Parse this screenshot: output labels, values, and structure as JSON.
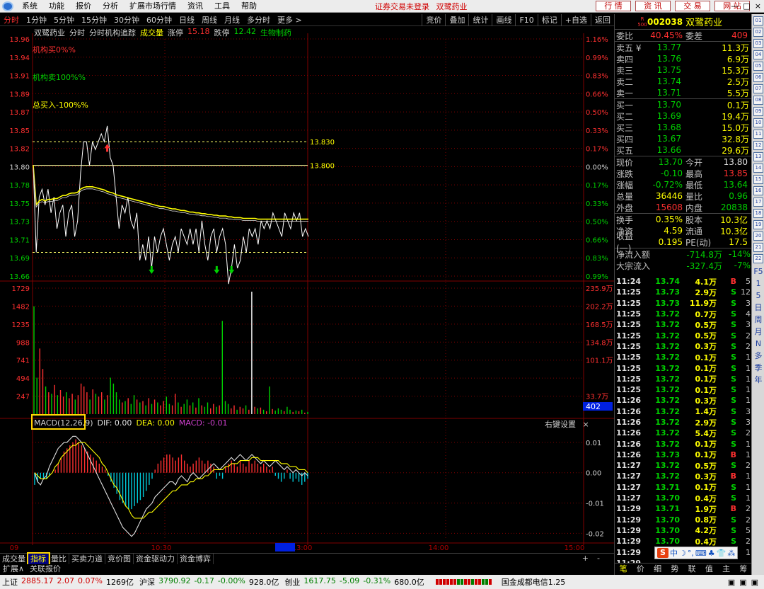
{
  "menubar": {
    "items": [
      "系统",
      "功能",
      "报价",
      "分析",
      "扩展市场行情",
      "资讯",
      "工具",
      "帮助"
    ],
    "login_status": "证券交易未登录",
    "login_stock": "双鹭药业",
    "buttons": [
      "行 情",
      "资 讯",
      "交 易",
      "网 站"
    ],
    "window_controls": [
      "—",
      "□",
      "×"
    ]
  },
  "periods": {
    "items": [
      "分时",
      "1分钟",
      "5分钟",
      "15分钟",
      "30分钟",
      "60分钟",
      "日线",
      "周线",
      "月线",
      "多分时",
      "更多 >"
    ],
    "active_index": 0,
    "tools": [
      "竞价",
      "叠加",
      "统计",
      "画线",
      "F10",
      "标记",
      "+自选",
      "返回"
    ]
  },
  "chart_header": {
    "stock_name": "双鹭药业",
    "mode": "分时",
    "tracker": "分时机构追踪",
    "volume_label": "成交量",
    "limit_up_label": "涨停",
    "limit_up_value": "15.18",
    "limit_down_label": "跌停",
    "limit_down_value": "12.42",
    "sector": "生物制药"
  },
  "overlay_labels": {
    "institution_buy": "机构买0%%",
    "institution_sell": "机构卖100%%",
    "total_buy": "总买入-100%%"
  },
  "macd_legend": {
    "title": "MACD(12,26,9)",
    "dif": "DIF: 0.00",
    "dea": "DEA: 0.00",
    "macd": "MACD: -0.01",
    "right_settings": "右键设置",
    "close": "×"
  },
  "chart_data": {
    "type": "line",
    "title": "",
    "price_axis": {
      "ticks": [
        "13.96",
        "13.94",
        "13.91",
        "13.89",
        "13.87",
        "13.85",
        "13.82",
        "13.80",
        "13.78",
        "13.75",
        "13.73",
        "13.71",
        "13.69",
        "13.66"
      ],
      "min": 13.66,
      "max": 13.96,
      "prev_close": 13.8
    },
    "pct_axis": {
      "ticks": [
        "1.16%",
        "0.99%",
        "0.83%",
        "0.66%",
        "0.50%",
        "0.33%",
        "0.17%",
        "0.00%",
        "0.17%",
        "0.33%",
        "0.50%",
        "0.66%",
        "0.83%",
        "0.99%"
      ]
    },
    "reference_lines": [
      {
        "label": "13.830",
        "value": 13.83
      },
      {
        "label": "13.800",
        "value": 13.8
      },
      {
        "label": "",
        "value": 13.69
      }
    ],
    "volume_axis": {
      "left_ticks": [
        "1729",
        "1482",
        "1235",
        "988",
        "741",
        "494",
        "247"
      ],
      "right_ticks": [
        "235.9万",
        "202.2万",
        "168.5万",
        "134.8万",
        "101.1万",
        "",
        "33.7万"
      ],
      "max": 1729,
      "cursor_label": "402"
    },
    "macd_axis": {
      "ticks": [
        "0.01",
        "0.00",
        "-0.01",
        "-0.02"
      ],
      "min": -0.022,
      "max": 0.013
    },
    "time_axis": {
      "labels": [
        "09",
        "10:30",
        "11:23",
        "13:00",
        "14:00",
        "15:00"
      ],
      "cursor_label": "11:23"
    },
    "series": [
      {
        "kind": "price",
        "values": [
          13.8,
          13.69,
          13.76,
          13.77,
          13.75,
          13.77,
          13.74,
          13.76,
          13.72,
          13.74,
          13.75,
          13.71,
          13.74,
          13.75,
          13.71,
          13.73,
          13.79,
          13.83,
          13.83,
          13.8,
          13.83,
          13.82,
          13.83,
          13.84,
          13.83,
          13.85,
          13.81,
          13.8,
          13.76,
          13.72,
          13.75,
          13.74,
          13.76,
          13.73,
          13.72,
          13.74,
          13.68,
          13.7,
          13.68,
          13.71,
          13.67,
          13.71,
          13.69,
          13.71,
          13.72,
          13.7,
          13.68,
          13.7,
          13.71,
          13.69,
          13.72,
          13.71,
          13.7,
          13.72,
          13.7,
          13.72,
          13.69,
          13.73,
          13.7,
          13.68,
          13.71,
          13.72,
          13.69,
          13.71,
          13.72,
          13.7,
          13.65,
          13.67,
          13.7,
          13.67,
          13.68,
          13.71,
          13.69,
          13.72,
          13.71,
          13.72,
          13.7,
          13.73,
          13.72,
          13.73,
          13.72,
          13.74,
          13.73,
          13.72,
          13.71,
          13.74,
          13.73,
          13.72,
          13.74,
          13.73,
          13.74,
          13.71,
          13.72,
          13.71
        ],
        "style": "white"
      },
      {
        "kind": "avg_price",
        "values": [
          13.8,
          13.75,
          13.755,
          13.757,
          13.755,
          13.757,
          13.757,
          13.758,
          13.758,
          13.76,
          13.762,
          13.762,
          13.764,
          13.765,
          13.765,
          13.766,
          13.77,
          13.772,
          13.773,
          13.773,
          13.773,
          13.772,
          13.771,
          13.77,
          13.769,
          13.767,
          13.766,
          13.765,
          13.763,
          13.762,
          13.761,
          13.76,
          13.759,
          13.758,
          13.757,
          13.756,
          13.755,
          13.754,
          13.753,
          13.752,
          13.751,
          13.75,
          13.749,
          13.748,
          13.748,
          13.747,
          13.746,
          13.745,
          13.745,
          13.744,
          13.743,
          13.743,
          13.742,
          13.741,
          13.741,
          13.74,
          13.74,
          13.739,
          13.739,
          13.738,
          13.738,
          13.737,
          13.737,
          13.736,
          13.736,
          13.736,
          13.735,
          13.735,
          13.734,
          13.734,
          13.734,
          13.733,
          13.733,
          13.733,
          13.733,
          13.733,
          13.732,
          13.732,
          13.732,
          13.732,
          13.732,
          13.732,
          13.732,
          13.732,
          13.732,
          13.732,
          13.732,
          13.732,
          13.732,
          13.732,
          13.732,
          13.732,
          13.732,
          13.732
        ],
        "style": "yellow"
      }
    ],
    "arrows": [
      {
        "type": "buy",
        "index": 25,
        "value": 13.82
      },
      {
        "type": "sell",
        "index": 40,
        "value": 13.67
      },
      {
        "type": "sell",
        "index": 62,
        "value": 13.67
      },
      {
        "type": "sell",
        "index": 67,
        "value": 13.67
      }
    ],
    "volumes": [
      1480,
      500,
      900,
      620,
      380,
      300,
      280,
      400,
      260,
      330,
      240,
      300,
      220,
      280,
      200,
      260,
      420,
      380,
      300,
      200,
      340,
      280,
      240,
      300,
      200,
      260,
      500,
      420,
      300,
      200,
      160,
      180,
      220,
      140,
      260,
      200,
      160,
      180,
      120,
      220,
      140,
      200,
      160,
      120,
      180,
      240,
      140,
      120,
      280,
      160,
      100,
      140,
      200,
      120,
      160,
      90,
      220,
      120,
      100,
      160,
      80,
      140,
      100,
      120,
      1280,
      180,
      140,
      80,
      120,
      60,
      100,
      80,
      120,
      60,
      1680,
      100,
      80,
      90,
      60,
      40,
      380,
      70,
      50,
      80,
      60,
      40,
      100,
      60,
      30,
      50,
      40,
      60,
      20,
      30
    ],
    "macd_hist": [
      -0.004,
      -0.003,
      -0.002,
      -0.002,
      -0.002,
      -0.001,
      0.0,
      0.001,
      0.003,
      0.005,
      0.007,
      0.008,
      0.009,
      0.01,
      0.011,
      0.01,
      0.009,
      0.008,
      0.007,
      0.006,
      0.005,
      0.004,
      0.003,
      0.002,
      0.001,
      -0.001,
      -0.003,
      -0.005,
      -0.007,
      -0.009,
      -0.01,
      -0.011,
      -0.012,
      -0.012,
      -0.011,
      -0.01,
      -0.009,
      -0.008,
      -0.006,
      -0.004,
      -0.002,
      0.001,
      0.003,
      0.004,
      0.005,
      0.006,
      0.006,
      0.005,
      0.004,
      0.005,
      0.006,
      0.004,
      0.003,
      0.002,
      0.003,
      0.004,
      0.005,
      0.004,
      0.003,
      0.004,
      0.003,
      0.002,
      -0.002,
      -0.001,
      -0.002,
      0.002,
      0.003,
      0.004,
      0.003,
      0.002,
      0.004,
      0.003,
      0.002,
      0.004,
      0.003,
      0.004,
      0.003,
      0.002,
      0.003,
      0.002,
      0.001,
      0.002,
      -0.001,
      -0.002,
      -0.003,
      -0.002,
      0.001,
      -0.002,
      -0.003,
      -0.002,
      -0.003,
      -0.004,
      -0.003,
      -0.002
    ],
    "macd_dif": [
      0.0,
      -0.003,
      -0.004,
      -0.002,
      -0.001,
      0.002,
      0.004,
      0.006,
      0.008,
      0.009,
      0.01,
      0.01,
      0.011,
      0.012,
      0.012,
      0.011,
      0.01,
      0.008,
      0.006,
      0.004,
      0.002,
      0.0,
      -0.002,
      -0.004,
      -0.006,
      -0.008,
      -0.01,
      -0.012,
      -0.014,
      -0.016,
      -0.018,
      -0.019,
      -0.02,
      -0.021,
      -0.02,
      -0.018,
      -0.016,
      -0.014,
      -0.012,
      -0.011,
      -0.01,
      -0.008,
      -0.007,
      -0.006,
      -0.005,
      -0.004,
      -0.003,
      -0.003,
      -0.004,
      -0.002,
      -0.001,
      -0.002,
      -0.003,
      -0.001,
      0.0,
      -0.001,
      -0.002,
      -0.001,
      0.0,
      0.001,
      0.002,
      0.003,
      0.002,
      0.001,
      0.002,
      0.003,
      0.004,
      0.005,
      0.004,
      0.005,
      0.006,
      0.005,
      0.004,
      0.005,
      0.006,
      0.005,
      0.004,
      0.003,
      0.004,
      0.003,
      0.002,
      0.003,
      0.004,
      0.003,
      0.002,
      0.001,
      0.002,
      0.001,
      0.0,
      0.001,
      0.0,
      -0.001,
      0.0,
      -0.001
    ],
    "macd_dea": [
      0.0,
      -0.001,
      -0.002,
      -0.002,
      -0.002,
      -0.001,
      0.0,
      0.002,
      0.003,
      0.005,
      0.006,
      0.007,
      0.008,
      0.009,
      0.009,
      0.01,
      0.01,
      0.01,
      0.009,
      0.008,
      0.007,
      0.006,
      0.005,
      0.003,
      0.002,
      0.0,
      -0.002,
      -0.004,
      -0.005,
      -0.007,
      -0.009,
      -0.011,
      -0.012,
      -0.014,
      -0.015,
      -0.015,
      -0.015,
      -0.015,
      -0.014,
      -0.013,
      -0.013,
      -0.012,
      -0.011,
      -0.01,
      -0.009,
      -0.008,
      -0.007,
      -0.006,
      -0.006,
      -0.005,
      -0.004,
      -0.004,
      -0.004,
      -0.003,
      -0.003,
      -0.002,
      -0.002,
      -0.002,
      -0.001,
      -0.001,
      0.0,
      0.001,
      0.001,
      0.001,
      0.001,
      0.002,
      0.002,
      0.003,
      0.003,
      0.003,
      0.004,
      0.004,
      0.004,
      0.004,
      0.005,
      0.005,
      0.005,
      0.004,
      0.004,
      0.004,
      0.004,
      0.004,
      0.004,
      0.004,
      0.003,
      0.003,
      0.003,
      0.002,
      0.002,
      0.002,
      0.001,
      0.001,
      0.001,
      0.0
    ]
  },
  "bottom_tabs": {
    "items": [
      "成交量",
      "指标",
      "量比",
      "买卖力道",
      "竞价图",
      "资金驱动力",
      "资金博弈"
    ],
    "active_index": 1,
    "controls": [
      "+",
      "-"
    ],
    "expand_row": [
      "扩展∧",
      "关联报价"
    ]
  },
  "statusbar": {
    "indices": [
      {
        "name": "上证",
        "value": "2885.17",
        "change": "2.07",
        "pct": "0.07%",
        "amount": "1269亿",
        "dir": "up"
      },
      {
        "name": "沪深",
        "value": "3790.92",
        "change": "-0.17",
        "pct": "-0.00%",
        "amount": "928.0亿",
        "dir": "down"
      },
      {
        "name": "创业",
        "value": "1617.75",
        "change": "-5.09",
        "pct": "-0.31%",
        "amount": "680.0亿",
        "dir": "down"
      }
    ],
    "news": "国金成都电信1.25"
  },
  "quote": {
    "r_badge": "R 500",
    "code": "002038",
    "name": "双鹭药业",
    "ratio_label": "委比",
    "ratio_value": "40.45%",
    "diff_label": "委差",
    "diff_value": "409",
    "asks": [
      {
        "label": "卖五 ¥",
        "price": "13.77",
        "vol": "11.3万"
      },
      {
        "label": "卖四",
        "price": "13.76",
        "vol": "6.9万"
      },
      {
        "label": "卖三",
        "price": "13.75",
        "vol": "15.3万"
      },
      {
        "label": "卖二",
        "price": "13.74",
        "vol": "2.5万"
      },
      {
        "label": "卖一",
        "price": "13.71",
        "vol": "5.5万"
      }
    ],
    "bids": [
      {
        "label": "买一",
        "price": "13.70",
        "vol": "0.1万"
      },
      {
        "label": "买二",
        "price": "13.69",
        "vol": "19.4万"
      },
      {
        "label": "买三",
        "price": "13.68",
        "vol": "15.0万"
      },
      {
        "label": "买四",
        "price": "13.67",
        "vol": "32.8万"
      },
      {
        "label": "买五",
        "price": "13.66",
        "vol": "29.6万"
      }
    ],
    "fields": [
      {
        "l1": "现价",
        "v1": "13.70",
        "c1": "down",
        "l2": "今开",
        "v2": "13.80",
        "c2": "wht"
      },
      {
        "l1": "涨跌",
        "v1": "-0.10",
        "c1": "down",
        "l2": "最高",
        "v2": "13.85",
        "c2": "up"
      },
      {
        "l1": "涨幅",
        "v1": "-0.72%",
        "c1": "down",
        "l2": "最低",
        "v2": "13.64",
        "c2": "down"
      },
      {
        "l1": "总量",
        "v1": "36446",
        "c1": "yel",
        "l2": "量比",
        "v2": "0.96",
        "c2": "down"
      },
      {
        "l1": "外盘",
        "v1": "15608",
        "c1": "up",
        "l2": "内盘",
        "v2": "20838",
        "c2": "down"
      },
      {
        "l1": "换手",
        "v1": "0.35%",
        "c1": "yel",
        "l2": "股本",
        "v2": "10.3亿",
        "c2": "yel"
      },
      {
        "l1": "净资",
        "v1": "4.59",
        "c1": "yel",
        "l2": "流通",
        "v2": "10.3亿",
        "c2": "yel"
      },
      {
        "l1": "收益(一)",
        "v1": "0.195",
        "c1": "yel",
        "l2": "PE(动)",
        "v2": "17.5",
        "c2": "yel"
      }
    ],
    "flows": [
      {
        "label": "净流入额",
        "value": "-714.8万",
        "pct": "-14%"
      },
      {
        "label": "大宗流入",
        "value": "-327.4万",
        "pct": "-7%"
      }
    ],
    "ticks": [
      {
        "t": "11:24",
        "p": "13.74",
        "v": "4.1万",
        "bs": "B",
        "n": "5"
      },
      {
        "t": "11:25",
        "p": "13.73",
        "v": "2.9万",
        "bs": "S",
        "n": "12"
      },
      {
        "t": "11:25",
        "p": "13.73",
        "v": "11.9万",
        "bs": "S",
        "n": "3"
      },
      {
        "t": "11:25",
        "p": "13.72",
        "v": "0.7万",
        "bs": "S",
        "n": "4"
      },
      {
        "t": "11:25",
        "p": "13.72",
        "v": "0.5万",
        "bs": "S",
        "n": "3"
      },
      {
        "t": "11:25",
        "p": "13.72",
        "v": "0.5万",
        "bs": "S",
        "n": "2"
      },
      {
        "t": "11:25",
        "p": "13.72",
        "v": "0.3万",
        "bs": "S",
        "n": "2"
      },
      {
        "t": "11:25",
        "p": "13.72",
        "v": "0.1万",
        "bs": "S",
        "n": "1"
      },
      {
        "t": "11:25",
        "p": "13.72",
        "v": "0.1万",
        "bs": "S",
        "n": "1"
      },
      {
        "t": "11:25",
        "p": "13.72",
        "v": "0.1万",
        "bs": "S",
        "n": "1"
      },
      {
        "t": "11:25",
        "p": "13.72",
        "v": "0.1万",
        "bs": "S",
        "n": "1"
      },
      {
        "t": "11:26",
        "p": "13.72",
        "v": "0.3万",
        "bs": "S",
        "n": "1"
      },
      {
        "t": "11:26",
        "p": "13.72",
        "v": "1.4万",
        "bs": "S",
        "n": "3"
      },
      {
        "t": "11:26",
        "p": "13.72",
        "v": "2.9万",
        "bs": "S",
        "n": "3"
      },
      {
        "t": "11:26",
        "p": "13.72",
        "v": "5.4万",
        "bs": "S",
        "n": "2"
      },
      {
        "t": "11:26",
        "p": "13.72",
        "v": "0.1万",
        "bs": "S",
        "n": "1"
      },
      {
        "t": "11:26",
        "p": "13.73",
        "v": "0.1万",
        "bs": "B",
        "n": "1"
      },
      {
        "t": "11:27",
        "p": "13.72",
        "v": "0.5万",
        "bs": "S",
        "n": "2"
      },
      {
        "t": "11:27",
        "p": "13.72",
        "v": "0.3万",
        "bs": "B",
        "n": "1"
      },
      {
        "t": "11:27",
        "p": "13.71",
        "v": "0.1万",
        "bs": "S",
        "n": "1"
      },
      {
        "t": "11:27",
        "p": "13.70",
        "v": "0.4万",
        "bs": "S",
        "n": "1"
      },
      {
        "t": "11:29",
        "p": "13.71",
        "v": "1.9万",
        "bs": "B",
        "n": "2"
      },
      {
        "t": "11:29",
        "p": "13.70",
        "v": "0.8万",
        "bs": "S",
        "n": "2"
      },
      {
        "t": "11:29",
        "p": "13.70",
        "v": "4.2万",
        "bs": "S",
        "n": "5"
      },
      {
        "t": "11:29",
        "p": "13.70",
        "v": "0.4万",
        "bs": "S",
        "n": "2"
      },
      {
        "t": "11:29",
        "p": "13.70",
        "v": "0.1万",
        "bs": "S",
        "n": "1"
      },
      {
        "t": "11:29",
        "p": "",
        "v": "",
        "bs": "",
        "n": ""
      }
    ],
    "ime_items": [
      "中",
      "☽",
      "°,",
      "⌨",
      "♣",
      "👕",
      "⁂"
    ],
    "panel_tabs": [
      "笔",
      "价",
      "细",
      "势",
      "联",
      "值",
      "主",
      "筹"
    ]
  },
  "side_strip": {
    "icons": [
      "01",
      "02",
      "03",
      "04",
      "05",
      "06",
      "07",
      "08",
      "09",
      "10",
      "11",
      "12",
      "13",
      "14",
      "15",
      "16",
      "17",
      "18",
      "19",
      "20",
      "21",
      "22"
    ],
    "texts": [
      "F5",
      "1",
      "5",
      "日",
      "周",
      "月",
      "N",
      "多",
      "季",
      "年"
    ]
  },
  "colors": {
    "up": "#ff3030",
    "down": "#00d000",
    "price_line": "#ffffff",
    "avg_line": "#ffff00",
    "ref_line_dashed": "#ffff66",
    "grid": "#800000",
    "highlight": "#ffd700"
  }
}
